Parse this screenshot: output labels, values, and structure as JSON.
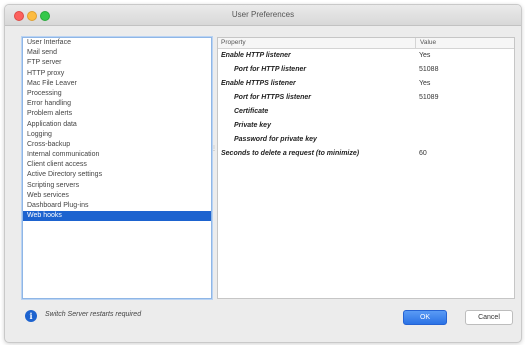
{
  "window": {
    "title": "User Preferences"
  },
  "sidebar": {
    "items": [
      {
        "label": "User Interface"
      },
      {
        "label": "Mail send"
      },
      {
        "label": "FTP server"
      },
      {
        "label": "HTTP proxy"
      },
      {
        "label": "Mac File Leaver"
      },
      {
        "label": "Processing"
      },
      {
        "label": "Error handling"
      },
      {
        "label": "Problem alerts"
      },
      {
        "label": "Application data"
      },
      {
        "label": "Logging"
      },
      {
        "label": "Cross-backup"
      },
      {
        "label": "Internal communication"
      },
      {
        "label": "Client client access"
      },
      {
        "label": "Active Directory settings"
      },
      {
        "label": "Scripting servers"
      },
      {
        "label": "Web services"
      },
      {
        "label": "Dashboard Plug-ins"
      },
      {
        "label": "Web hooks"
      }
    ],
    "selected_index": 17
  },
  "properties": {
    "header": {
      "property": "Property",
      "value": "Value"
    },
    "rows": [
      {
        "name": "Enable HTTP listener",
        "value": "Yes",
        "indent": 0
      },
      {
        "name": "Port for HTTP listener",
        "value": "51088",
        "indent": 1
      },
      {
        "name": "Enable HTTPS listener",
        "value": "Yes",
        "indent": 0
      },
      {
        "name": "Port for HTTPS listener",
        "value": "51089",
        "indent": 1
      },
      {
        "name": "Certificate",
        "value": "",
        "indent": 1
      },
      {
        "name": "Private key",
        "value": "",
        "indent": 1
      },
      {
        "name": "Password for private key",
        "value": "",
        "indent": 1
      },
      {
        "name": "Seconds to delete a request (to minimize)",
        "value": "60",
        "indent": 0
      }
    ]
  },
  "footer": {
    "info_icon": "info-icon",
    "message": "Switch Server restarts required",
    "ok_label": "OK",
    "cancel_label": "Cancel"
  },
  "colors": {
    "accent": "#1d63cf",
    "selection": "#1d63cf"
  }
}
